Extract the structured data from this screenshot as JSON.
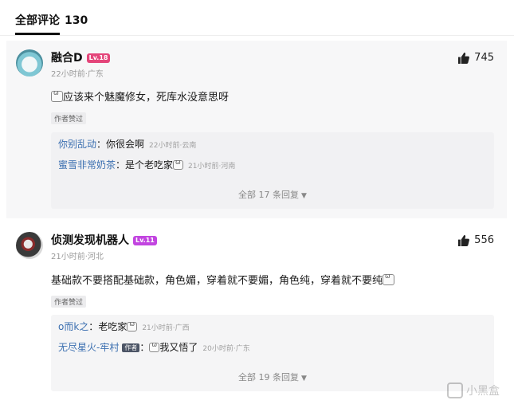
{
  "header": {
    "title": "全部评论",
    "count": "130"
  },
  "comments": [
    {
      "user": "融合D",
      "level": "Lv.18",
      "level_color": "#e4457a",
      "meta": "22小时前·广东",
      "likes": "745",
      "content": "应该来个魅魔修女，死库水没意思呀",
      "tag": "作者赞过",
      "replies": [
        {
          "who": "你别乱动",
          "sep": "：",
          "text": "你很会啊",
          "time": "22小时前·云南"
        },
        {
          "who": "蜜雪非常奶茶",
          "sep": "：",
          "text": "是个老吃家",
          "time": "21小时前·河南"
        }
      ],
      "expand": "全部 17 条回复"
    },
    {
      "user": "侦测发现机器人",
      "level": "Lv.11",
      "level_color": "#c245e0",
      "meta": "21小时前·河北",
      "likes": "556",
      "content": "基础款不要搭配基础款，角色媚，穿着就不要媚，角色纯，穿着就不要纯",
      "tag": "作者赞过",
      "replies": [
        {
          "who": "o而k之",
          "sep": "：",
          "text": "老吃家",
          "time": "21小时前·广西"
        },
        {
          "who": "无尽星火-牢村",
          "badge": "作者",
          "sep": "：",
          "text": "我又悟了",
          "time": "20小时前·广东"
        }
      ],
      "expand": "全部 19 条回复"
    }
  ],
  "watermark": "小黑盒",
  "icons": {
    "like": "thumbs-up-icon",
    "expand": "caret-down-icon",
    "emoji": "emoji-icon"
  }
}
